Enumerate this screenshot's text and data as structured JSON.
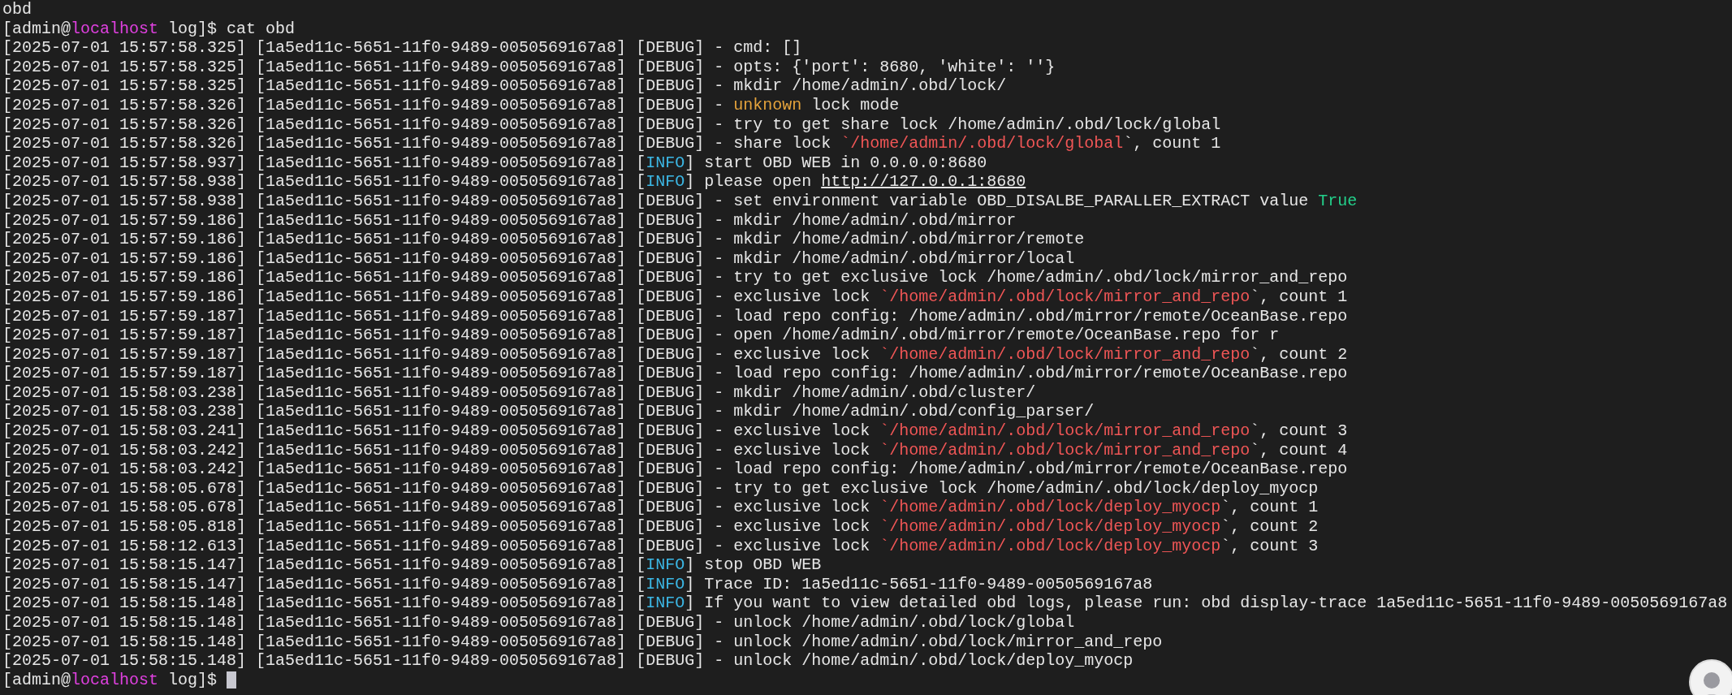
{
  "lines": [
    {
      "segments": [
        {
          "kind": "plain",
          "text": "obd"
        }
      ]
    },
    {
      "segments": [
        {
          "kind": "plain",
          "text": "[admin@"
        },
        {
          "kind": "host",
          "text": "localhost"
        },
        {
          "kind": "plain",
          "text": " log]$ cat obd"
        }
      ]
    },
    {
      "segments": [
        {
          "kind": "plain",
          "text": "[2025-07-01 15:57:58.325] [1a5ed11c-5651-11f0-9489-0050569167a8] [DEBUG] - cmd: []"
        }
      ]
    },
    {
      "segments": [
        {
          "kind": "plain",
          "text": "[2025-07-01 15:57:58.325] [1a5ed11c-5651-11f0-9489-0050569167a8] [DEBUG] - opts: {'port': 8680, 'white': ''}"
        }
      ]
    },
    {
      "segments": [
        {
          "kind": "plain",
          "text": "[2025-07-01 15:57:58.325] [1a5ed11c-5651-11f0-9489-0050569167a8] [DEBUG] - mkdir /home/admin/.obd/lock/"
        }
      ]
    },
    {
      "segments": [
        {
          "kind": "plain",
          "text": "[2025-07-01 15:57:58.326] [1a5ed11c-5651-11f0-9489-0050569167a8] [DEBUG] - "
        },
        {
          "kind": "warn",
          "text": "unknown"
        },
        {
          "kind": "plain",
          "text": " lock mode"
        }
      ]
    },
    {
      "segments": [
        {
          "kind": "plain",
          "text": "[2025-07-01 15:57:58.326] [1a5ed11c-5651-11f0-9489-0050569167a8] [DEBUG] - try to get share lock /home/admin/.obd/lock/global"
        }
      ]
    },
    {
      "segments": [
        {
          "kind": "plain",
          "text": "[2025-07-01 15:57:58.326] [1a5ed11c-5651-11f0-9489-0050569167a8] [DEBUG] - share lock "
        },
        {
          "kind": "path",
          "text": "`/home/admin/.obd/lock/global"
        },
        {
          "kind": "plain",
          "text": "`, count 1"
        }
      ]
    },
    {
      "segments": [
        {
          "kind": "plain",
          "text": "[2025-07-01 15:57:58.937] [1a5ed11c-5651-11f0-9489-0050569167a8] ["
        },
        {
          "kind": "info",
          "text": "INFO"
        },
        {
          "kind": "plain",
          "text": "] start OBD WEB in 0.0.0.0:8680"
        }
      ]
    },
    {
      "segments": [
        {
          "kind": "plain",
          "text": "[2025-07-01 15:57:58.938] [1a5ed11c-5651-11f0-9489-0050569167a8] ["
        },
        {
          "kind": "info",
          "text": "INFO"
        },
        {
          "kind": "plain",
          "text": "] please open "
        },
        {
          "kind": "link",
          "text": "http://127.0.0.1:8680"
        }
      ]
    },
    {
      "segments": [
        {
          "kind": "plain",
          "text": "[2025-07-01 15:57:58.938] [1a5ed11c-5651-11f0-9489-0050569167a8] [DEBUG] - set environment variable OBD_DISALBE_PARALLER_EXTRACT value "
        },
        {
          "kind": "true",
          "text": "True"
        }
      ]
    },
    {
      "segments": [
        {
          "kind": "plain",
          "text": "[2025-07-01 15:57:59.186] [1a5ed11c-5651-11f0-9489-0050569167a8] [DEBUG] - mkdir /home/admin/.obd/mirror"
        }
      ]
    },
    {
      "segments": [
        {
          "kind": "plain",
          "text": "[2025-07-01 15:57:59.186] [1a5ed11c-5651-11f0-9489-0050569167a8] [DEBUG] - mkdir /home/admin/.obd/mirror/remote"
        }
      ]
    },
    {
      "segments": [
        {
          "kind": "plain",
          "text": "[2025-07-01 15:57:59.186] [1a5ed11c-5651-11f0-9489-0050569167a8] [DEBUG] - mkdir /home/admin/.obd/mirror/local"
        }
      ]
    },
    {
      "segments": [
        {
          "kind": "plain",
          "text": "[2025-07-01 15:57:59.186] [1a5ed11c-5651-11f0-9489-0050569167a8] [DEBUG] - try to get exclusive lock /home/admin/.obd/lock/mirror_and_repo"
        }
      ]
    },
    {
      "segments": [
        {
          "kind": "plain",
          "text": "[2025-07-01 15:57:59.186] [1a5ed11c-5651-11f0-9489-0050569167a8] [DEBUG] - exclusive lock "
        },
        {
          "kind": "path",
          "text": "`/home/admin/.obd/lock/mirror_and_repo"
        },
        {
          "kind": "plain",
          "text": "`, count 1"
        }
      ]
    },
    {
      "segments": [
        {
          "kind": "plain",
          "text": "[2025-07-01 15:57:59.187] [1a5ed11c-5651-11f0-9489-0050569167a8] [DEBUG] - load repo config: /home/admin/.obd/mirror/remote/OceanBase.repo"
        }
      ]
    },
    {
      "segments": [
        {
          "kind": "plain",
          "text": "[2025-07-01 15:57:59.187] [1a5ed11c-5651-11f0-9489-0050569167a8] [DEBUG] - open /home/admin/.obd/mirror/remote/OceanBase.repo for r"
        }
      ]
    },
    {
      "segments": [
        {
          "kind": "plain",
          "text": "[2025-07-01 15:57:59.187] [1a5ed11c-5651-11f0-9489-0050569167a8] [DEBUG] - exclusive lock "
        },
        {
          "kind": "path",
          "text": "`/home/admin/.obd/lock/mirror_and_repo"
        },
        {
          "kind": "plain",
          "text": "`, count 2"
        }
      ]
    },
    {
      "segments": [
        {
          "kind": "plain",
          "text": "[2025-07-01 15:57:59.187] [1a5ed11c-5651-11f0-9489-0050569167a8] [DEBUG] - load repo config: /home/admin/.obd/mirror/remote/OceanBase.repo"
        }
      ]
    },
    {
      "segments": [
        {
          "kind": "plain",
          "text": "[2025-07-01 15:58:03.238] [1a5ed11c-5651-11f0-9489-0050569167a8] [DEBUG] - mkdir /home/admin/.obd/cluster/"
        }
      ]
    },
    {
      "segments": [
        {
          "kind": "plain",
          "text": "[2025-07-01 15:58:03.238] [1a5ed11c-5651-11f0-9489-0050569167a8] [DEBUG] - mkdir /home/admin/.obd/config_parser/"
        }
      ]
    },
    {
      "segments": [
        {
          "kind": "plain",
          "text": "[2025-07-01 15:58:03.241] [1a5ed11c-5651-11f0-9489-0050569167a8] [DEBUG] - exclusive lock "
        },
        {
          "kind": "path",
          "text": "`/home/admin/.obd/lock/mirror_and_repo"
        },
        {
          "kind": "plain",
          "text": "`, count 3"
        }
      ]
    },
    {
      "segments": [
        {
          "kind": "plain",
          "text": "[2025-07-01 15:58:03.242] [1a5ed11c-5651-11f0-9489-0050569167a8] [DEBUG] - exclusive lock "
        },
        {
          "kind": "path",
          "text": "`/home/admin/.obd/lock/mirror_and_repo"
        },
        {
          "kind": "plain",
          "text": "`, count 4"
        }
      ]
    },
    {
      "segments": [
        {
          "kind": "plain",
          "text": "[2025-07-01 15:58:03.242] [1a5ed11c-5651-11f0-9489-0050569167a8] [DEBUG] - load repo config: /home/admin/.obd/mirror/remote/OceanBase.repo"
        }
      ]
    },
    {
      "segments": [
        {
          "kind": "plain",
          "text": "[2025-07-01 15:58:05.678] [1a5ed11c-5651-11f0-9489-0050569167a8] [DEBUG] - try to get exclusive lock /home/admin/.obd/lock/deploy_myocp"
        }
      ]
    },
    {
      "segments": [
        {
          "kind": "plain",
          "text": "[2025-07-01 15:58:05.678] [1a5ed11c-5651-11f0-9489-0050569167a8] [DEBUG] - exclusive lock "
        },
        {
          "kind": "path",
          "text": "`/home/admin/.obd/lock/deploy_myocp"
        },
        {
          "kind": "plain",
          "text": "`, count 1"
        }
      ]
    },
    {
      "segments": [
        {
          "kind": "plain",
          "text": "[2025-07-01 15:58:05.818] [1a5ed11c-5651-11f0-9489-0050569167a8] [DEBUG] - exclusive lock "
        },
        {
          "kind": "path",
          "text": "`/home/admin/.obd/lock/deploy_myocp"
        },
        {
          "kind": "plain",
          "text": "`, count 2"
        }
      ]
    },
    {
      "segments": [
        {
          "kind": "plain",
          "text": "[2025-07-01 15:58:12.613] [1a5ed11c-5651-11f0-9489-0050569167a8] [DEBUG] - exclusive lock "
        },
        {
          "kind": "path",
          "text": "`/home/admin/.obd/lock/deploy_myocp"
        },
        {
          "kind": "plain",
          "text": "`, count 3"
        }
      ]
    },
    {
      "segments": [
        {
          "kind": "plain",
          "text": "[2025-07-01 15:58:15.147] [1a5ed11c-5651-11f0-9489-0050569167a8] ["
        },
        {
          "kind": "info",
          "text": "INFO"
        },
        {
          "kind": "plain",
          "text": "] stop OBD WEB"
        }
      ]
    },
    {
      "segments": [
        {
          "kind": "plain",
          "text": "[2025-07-01 15:58:15.147] [1a5ed11c-5651-11f0-9489-0050569167a8] ["
        },
        {
          "kind": "info",
          "text": "INFO"
        },
        {
          "kind": "plain",
          "text": "] Trace ID: 1a5ed11c-5651-11f0-9489-0050569167a8"
        }
      ]
    },
    {
      "segments": [
        {
          "kind": "plain",
          "text": "[2025-07-01 15:58:15.148] [1a5ed11c-5651-11f0-9489-0050569167a8] ["
        },
        {
          "kind": "info",
          "text": "INFO"
        },
        {
          "kind": "plain",
          "text": "] If you want to view detailed obd logs, please run: obd display-trace 1a5ed11c-5651-11f0-9489-0050569167a8"
        }
      ]
    },
    {
      "segments": [
        {
          "kind": "plain",
          "text": "[2025-07-01 15:58:15.148] [1a5ed11c-5651-11f0-9489-0050569167a8] [DEBUG] - unlock /home/admin/.obd/lock/global"
        }
      ]
    },
    {
      "segments": [
        {
          "kind": "plain",
          "text": "[2025-07-01 15:58:15.148] [1a5ed11c-5651-11f0-9489-0050569167a8] [DEBUG] - unlock /home/admin/.obd/lock/mirror_and_repo"
        }
      ]
    },
    {
      "segments": [
        {
          "kind": "plain",
          "text": "[2025-07-01 15:58:15.148] [1a5ed11c-5651-11f0-9489-0050569167a8] [DEBUG] - unlock /home/admin/.obd/lock/deploy_myocp"
        }
      ]
    },
    {
      "segments": [
        {
          "kind": "plain",
          "text": "[admin@"
        },
        {
          "kind": "host",
          "text": "localhost"
        },
        {
          "kind": "plain",
          "text": " log]$ "
        }
      ],
      "cursor": true
    }
  ]
}
